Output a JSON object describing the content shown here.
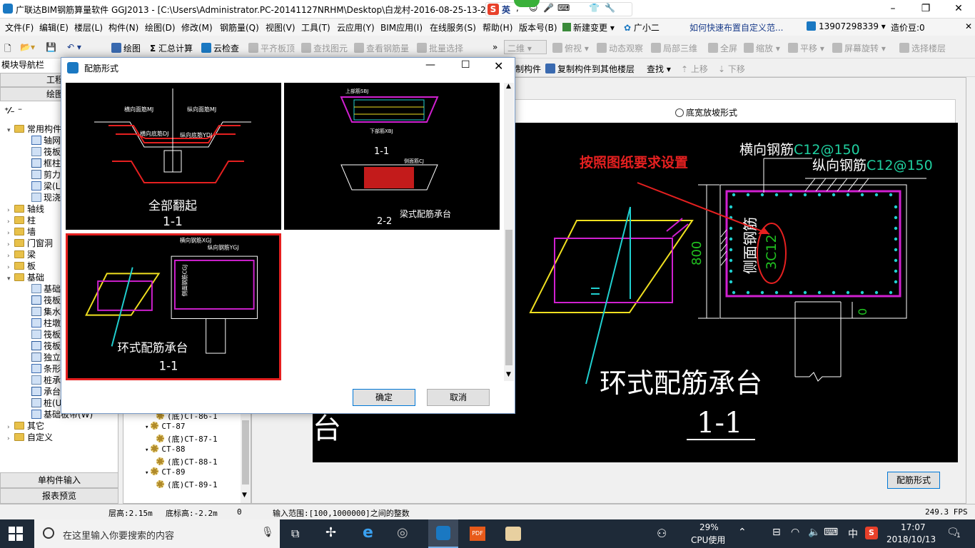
{
  "title": {
    "text": "广联达BIM钢筋算量软件 GGJ2013 - [C:\\Users\\Administrator.PC-20141127NRHM\\Desktop\\白龙村-2016-08-25-13-27",
    "minimize": "–",
    "restore": "❐",
    "close": "✕"
  },
  "ime": {
    "label": "英"
  },
  "menu": [
    "文件(F)",
    "编辑(E)",
    "楼层(L)",
    "构件(N)",
    "绘图(D)",
    "修改(M)",
    "钢筋量(Q)",
    "视图(V)",
    "工具(T)",
    "云应用(Y)",
    "BIM应用(I)",
    "在线服务(S)",
    "帮助(H)",
    "版本号(B)",
    "新建变更",
    "广小二"
  ],
  "menu_right": {
    "help_link": "如何快速布置自定义范...",
    "phone": "13907298339",
    "bean": "造价豆:0"
  },
  "toolbar1": {
    "draw": "绘图",
    "sum": "汇总计算",
    "cloud_check": "云检查",
    "align_top": "平齐板顶",
    "find_element": "查找图元",
    "view_rebar": "查看钢筋量",
    "batch_select": "批量选择",
    "view_2d": "二维",
    "view_top": "俯视",
    "dynamic": "动态观察",
    "local_3d": "局部三维",
    "fullscreen": "全屏",
    "zoom": "缩放",
    "pan": "平移",
    "rotate": "屏幕旋转",
    "select_floor": "选择楼层"
  },
  "toolbar2": {
    "copy_el": "制构件",
    "copy_other": "复制构件到其他楼层",
    "find": "查找",
    "up": "上移",
    "down": "下移"
  },
  "nav": {
    "title": "模块导航栏",
    "tab_project": "工程设",
    "tab_draw": "绘图输",
    "tree_top": [
      {
        "label": "常用构件",
        "expanded": true
      },
      {
        "label": "轴网",
        "child": true
      },
      {
        "label": "筏板",
        "child": true
      },
      {
        "label": "框柱",
        "child": true
      },
      {
        "label": "剪力",
        "child": true
      },
      {
        "label": "梁(L)",
        "child": true
      },
      {
        "label": "现浇",
        "child": true
      },
      {
        "label": "轴线"
      },
      {
        "label": "柱"
      },
      {
        "label": "墙"
      },
      {
        "label": "门窗洞"
      },
      {
        "label": "梁"
      },
      {
        "label": "板"
      },
      {
        "label": "基础",
        "expanded": true
      },
      {
        "label": "基础",
        "child": true
      },
      {
        "label": "筏板",
        "child": true
      },
      {
        "label": "集水",
        "child": true
      },
      {
        "label": "柱墩",
        "child": true
      },
      {
        "label": "筏板",
        "child": true
      },
      {
        "label": "筏板",
        "child": true
      },
      {
        "label": "独立",
        "child": true
      },
      {
        "label": "条形",
        "child": true
      },
      {
        "label": "桩承",
        "child": true
      },
      {
        "label": "承台",
        "child": true
      },
      {
        "label": "桩(U)",
        "child": true
      },
      {
        "label": "基础板带(W)",
        "child": true
      },
      {
        "label": "其它"
      },
      {
        "label": "自定义"
      }
    ],
    "bottom_single": "单构件输入",
    "bottom_report": "报表预览"
  },
  "midlist": [
    {
      "label": "(底)CT-86-1",
      "level": 2
    },
    {
      "label": "CT-87",
      "level": 1
    },
    {
      "label": "(底)CT-87-1",
      "level": 2
    },
    {
      "label": "CT-88",
      "level": 1
    },
    {
      "label": "(底)CT-88-1",
      "level": 2
    },
    {
      "label": "CT-89",
      "level": 1
    },
    {
      "label": "(底)CT-89-1",
      "level": 2
    }
  ],
  "rightpanel": {
    "radio_label": "底宽放坡形式",
    "canvas": {
      "annotation": "按照图纸要求设置",
      "transverse": "横向钢筋",
      "transverse_val": "C12@150",
      "longitudinal": "纵向钢筋",
      "longitudinal_val": "C12@150",
      "side": "侧面钢筋",
      "side_val": "3C12",
      "dim_height": "800",
      "dim_zero": "0",
      "caption": "环式配筋承台",
      "caption_sub": "1-1"
    },
    "rebar_form_button": "配筋形式"
  },
  "dialog": {
    "title": "配筋形式",
    "thumbs": [
      {
        "caption": "全部翻起",
        "sub": "1-1",
        "selected": false
      },
      {
        "caption": "梁式配筋承台",
        "sub1": "1-1",
        "sub2": "2-2",
        "selected": false
      },
      {
        "caption": "环式配筋承台",
        "sub": "1-1",
        "selected": true
      }
    ],
    "thumb_labels": {
      "t1_a": "横向面筋MJ",
      "t1_b": "纵向面筋MJ",
      "t1_c": "横向底筋DJ",
      "t1_d": "纵向底筋YDJ",
      "t2_a": "上部筋SBJ",
      "t2_b": "下部筋XBJ",
      "t2_c": "侧面筋CJ",
      "t3_a": "横向钢筋XGJ",
      "t3_b": "纵向钢筋YGJ",
      "t3_c": "侧面钢筋CGJ"
    },
    "ok": "确定",
    "cancel": "取消"
  },
  "status": {
    "floor_height": "层高:2.15m",
    "bottom_elev": "底标高:-2.2m",
    "zero": "0",
    "input_range": "输入范围:[100,1000000]之间的整数",
    "fps": "249.3 FPS"
  },
  "taskbar": {
    "search_placeholder": "在这里输入你要搜索的内容",
    "cpu_pct": "29%",
    "cpu_label": "CPU使用",
    "lang": "中",
    "time": "17:07",
    "date": "2018/10/13",
    "notif_count": "1"
  },
  "colors": {
    "accent": "#0078d7",
    "red": "#e52020",
    "magenta": "#d020d0",
    "cyan": "#20d0d0",
    "yellow": "#f0e020",
    "green": "#20c020"
  }
}
